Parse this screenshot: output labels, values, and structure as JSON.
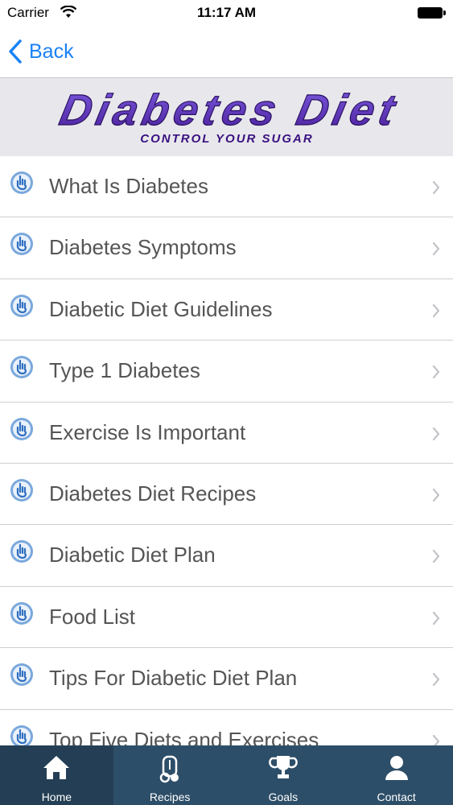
{
  "status_bar": {
    "carrier": "Carrier",
    "time": "11:17 AM"
  },
  "nav": {
    "back_label": "Back"
  },
  "banner": {
    "title": "Diabetes Diet",
    "subtitle": "CONTROL YOUR SUGAR"
  },
  "menu": {
    "items": [
      {
        "label": "What Is Diabetes"
      },
      {
        "label": "Diabetes Symptoms"
      },
      {
        "label": "Diabetic Diet Guidelines"
      },
      {
        "label": "Type 1 Diabetes"
      },
      {
        "label": "Exercise Is Important"
      },
      {
        "label": "Diabetes Diet Recipes"
      },
      {
        "label": "Diabetic Diet Plan"
      },
      {
        "label": "Food List"
      },
      {
        "label": "Tips For Diabetic Diet Plan"
      },
      {
        "label": "Top Five Diets and Exercises"
      }
    ]
  },
  "tabs": [
    {
      "label": "Home",
      "icon": "home-icon",
      "active": true
    },
    {
      "label": "Recipes",
      "icon": "recipes-icon",
      "active": false
    },
    {
      "label": "Goals",
      "icon": "trophy-icon",
      "active": false
    },
    {
      "label": "Contact",
      "icon": "contact-icon",
      "active": false
    }
  ],
  "colors": {
    "accent": "#1a82f6",
    "tab_bar": "#2d4e68",
    "tab_active": "#243f55",
    "banner_purple": "#5b2fb0"
  }
}
